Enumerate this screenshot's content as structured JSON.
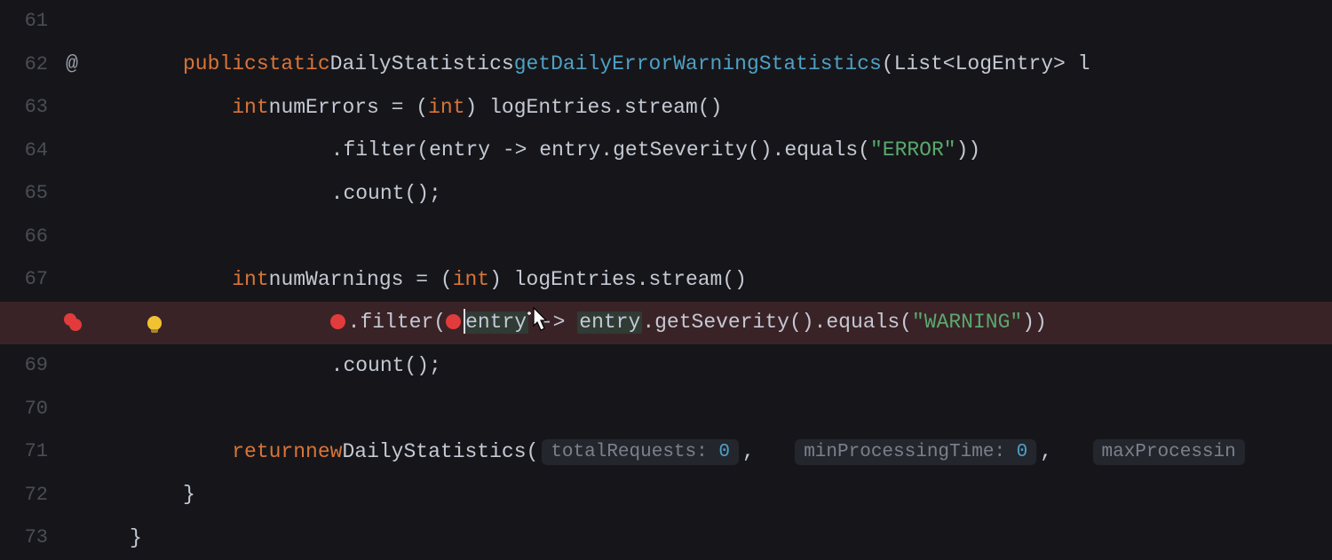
{
  "lines": {
    "l61": "61",
    "l62": "62",
    "l63": "63",
    "l64": "64",
    "l65": "65",
    "l66": "66",
    "l67": "67",
    "l68": "",
    "l69": "69",
    "l70": "70",
    "l71": "71",
    "l72": "72",
    "l73": "73"
  },
  "annot": "@",
  "kw": {
    "public": "public",
    "static": "static",
    "int": "int",
    "return": "return",
    "new": "new"
  },
  "sig": {
    "rettype": "DailyStatistics",
    "fname": "getDailyErrorWarningStatistics",
    "paramtype_open": "(List<LogEntry> ",
    "dotslast": "l"
  },
  "v": {
    "numErrors": "numErrors",
    "numWarnings": "numWarnings",
    "assign_cast_open": " = (",
    "cast_close": ") ",
    "logEntries_stream": "logEntries.stream()"
  },
  "chain": {
    "filter_open": ".filter(",
    "entry": "entry",
    "arrow": " -> ",
    "entry_get": "entry.getSeverity().equals(",
    "close2": "))",
    "count": ".count();"
  },
  "str": {
    "error": "\"ERROR\"",
    "warning": "\"WARNING\""
  },
  "ret": {
    "ds_open": "DailyStatistics(",
    "comma": ",",
    "space": "   "
  },
  "inlay": {
    "totalRequests": "totalRequests:",
    "zero1": "0",
    "minProc": "minProcessingTime:",
    "zero2": "0",
    "maxProc": "maxProcessin"
  },
  "brace_close": "}",
  "indent": {
    "i1": "    ",
    "i2": "        ",
    "i3": "            "
  }
}
